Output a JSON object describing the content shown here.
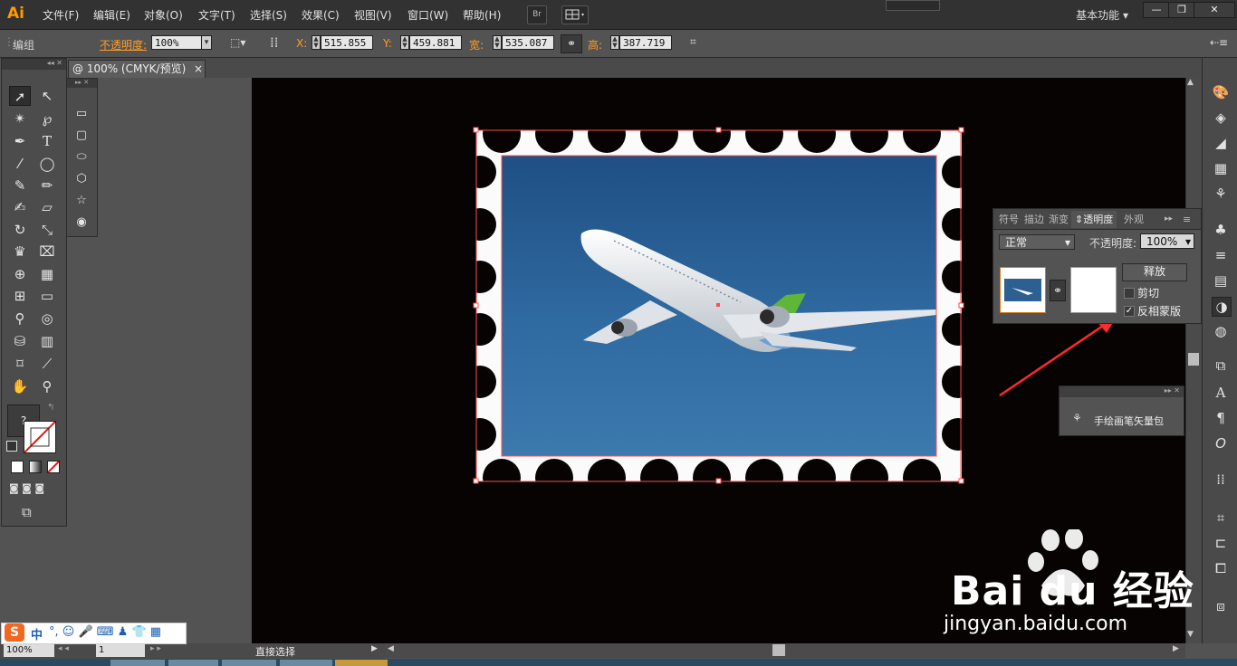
{
  "app": {
    "logo": "Ai"
  },
  "menu": [
    "文件(F)",
    "编辑(E)",
    "对象(O)",
    "文字(T)",
    "选择(S)",
    "效果(C)",
    "视图(V)",
    "窗口(W)",
    "帮助(H)"
  ],
  "menubar_extra": {
    "bridge": "Br",
    "workspace": "基本功能",
    "minimize": "—",
    "restore": "❐",
    "close": "✕"
  },
  "control": {
    "object_type": "编组",
    "opacity_label": "不透明度:",
    "opacity_value": "100%",
    "x_label": "X:",
    "x_value": "515.855",
    "y_label": "Y:",
    "y_value": "459.881",
    "w_label": "宽:",
    "w_value": "535.087",
    "h_label": "高:",
    "h_value": "387.719"
  },
  "document_tab": {
    "title": "@ 100% (CMYK/预览)",
    "close": "×"
  },
  "transparency_panel": {
    "tabs": [
      "符号",
      "描边",
      "渐变",
      "透明度",
      "外观"
    ],
    "blend_mode": "正常",
    "opacity_label": "不透明度:",
    "opacity_value": "100%",
    "release_button": "释放",
    "clip_label": "剪切",
    "clip_checked": false,
    "invert_label": "反相蒙版",
    "invert_checked": true
  },
  "brush_panel": {
    "item": "手绘画笔矢量包"
  },
  "status": {
    "zoom": "100%",
    "page": "1",
    "tool": "直接选择"
  },
  "ime": {
    "logo": "S",
    "mode": "中"
  },
  "watermark": {
    "brand": "Bai du 经验",
    "url": "jingyan.baidu.com"
  },
  "tool_names": [
    "selection-tool",
    "direct-selection-tool",
    "magic-wand-tool",
    "lasso-tool",
    "pen-tool",
    "type-tool",
    "line-tool",
    "ellipse-tool",
    "paintbrush-tool",
    "pencil-tool",
    "blob-brush-tool",
    "eraser-tool",
    "rotate-tool",
    "scale-tool",
    "warp-tool",
    "free-transform-tool",
    "shape-builder-tool",
    "perspective-grid-tool",
    "mesh-tool",
    "gradient-tool",
    "eyedropper-tool",
    "blend-tool",
    "symbol-sprayer-tool",
    "column-graph-tool",
    "artboard-tool",
    "slice-tool",
    "hand-tool",
    "zoom-tool"
  ],
  "colors": {
    "accent": "#ff9c26",
    "selection": "#ff3b3b",
    "canvas": "#070303",
    "sky": "#2e5f93"
  }
}
